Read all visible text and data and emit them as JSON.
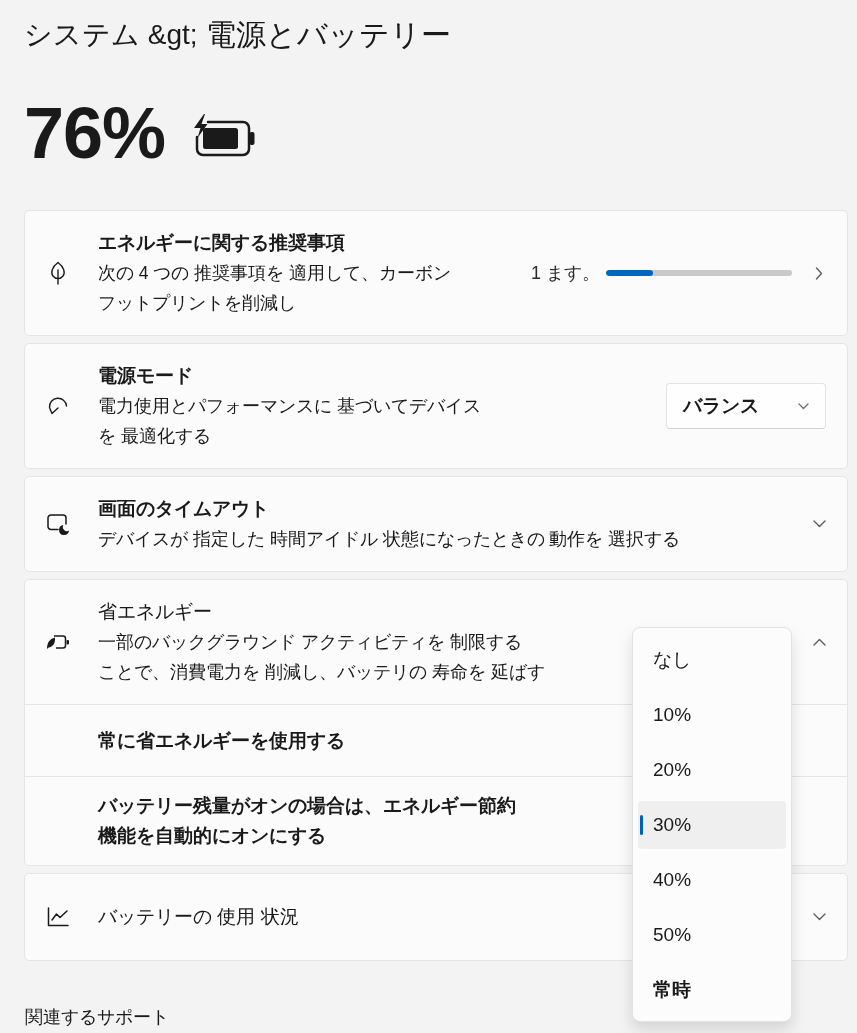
{
  "breadcrumb": {
    "parent": "システム &gt;",
    "current": "電源とバッテリー"
  },
  "battery": {
    "percent": "76%",
    "charging": true
  },
  "cards": [
    {
      "kind": "progress",
      "title": "エネルギーに関する推奨事項",
      "title_bold": true,
      "description_lines": [
        "次の 4 つの 推奨事項を 適用して、カーボン",
        "フットプリントを削減し"
      ],
      "progress_text": "1 ます。",
      "level": 0.25
    },
    {
      "kind": "dropdown",
      "title": "電源モード",
      "title_bold": true,
      "description_lines": [
        "電力使用とパフォーマンスに 基づいてデバイス",
        "を 最適化する"
      ],
      "value": "バランス"
    },
    {
      "kind": "expander",
      "title": "画面のタイムアウト",
      "title_bold": true,
      "description_lines": [
        "デバイスが 指定した 時間アイドル 状態になったときの 動作を 選択する"
      ],
      "expanded": false
    },
    {
      "kind": "expander",
      "title": "省エネルギー",
      "title_bold": false,
      "description_lines": [
        "一部のバックグラウンド アクティビティを 制限する",
        "ことで、消費電力を 削減し、バッテリの 寿命を 延ばす"
      ],
      "expanded": true,
      "children": [
        {
          "label_lines": [
            "常に省エネルギーを使用する"
          ]
        },
        {
          "label_lines": [
            "バッテリー残量がオンの場合は、エネルギー節約",
            "機能を自動的にオンにする"
          ]
        }
      ]
    },
    {
      "kind": "expander",
      "title": "バッテリーの 使用 状況",
      "title_bold": false,
      "expanded": false
    }
  ],
  "threshold_menu": {
    "options": [
      {
        "label": "なし",
        "selected": false,
        "bold": false
      },
      {
        "label": "10%",
        "selected": false,
        "bold": false
      },
      {
        "label": "20%",
        "selected": false,
        "bold": false
      },
      {
        "label": "30%",
        "selected": true,
        "bold": false
      },
      {
        "label": "40%",
        "selected": false,
        "bold": false
      },
      {
        "label": "50%",
        "selected": false,
        "bold": false
      },
      {
        "label": "常時",
        "selected": false,
        "bold": true
      }
    ]
  },
  "related_heading": "関連するサポート"
}
